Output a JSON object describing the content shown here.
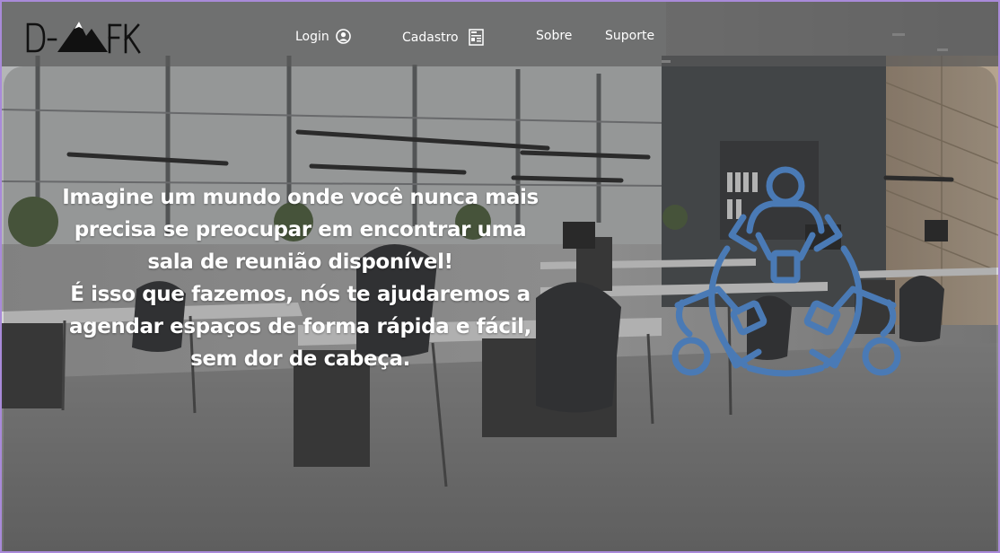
{
  "header": {
    "logo_text": "D-AFK",
    "nav": {
      "login": "Login",
      "cadastro": "Cadastro",
      "sobre": "Sobre",
      "suporte": "Suporte"
    }
  },
  "hero": {
    "lines": [
      "Imagine um mundo onde você nunca mais",
      "precisa se preocupar em encontrar uma",
      "sala de reunião disponível!",
      "É isso que fazemos, nós te ajudaremos a",
      "agendar espaços de forma rápida e fácil,",
      "sem dor de cabeça."
    ]
  },
  "colors": {
    "frame_border": "#a98ad9",
    "header_bg": "#555555",
    "icon_blue": "#4a7ab5",
    "text": "#ffffff"
  },
  "icons": [
    "user-icon",
    "form-icon",
    "team-collaboration-icon"
  ]
}
